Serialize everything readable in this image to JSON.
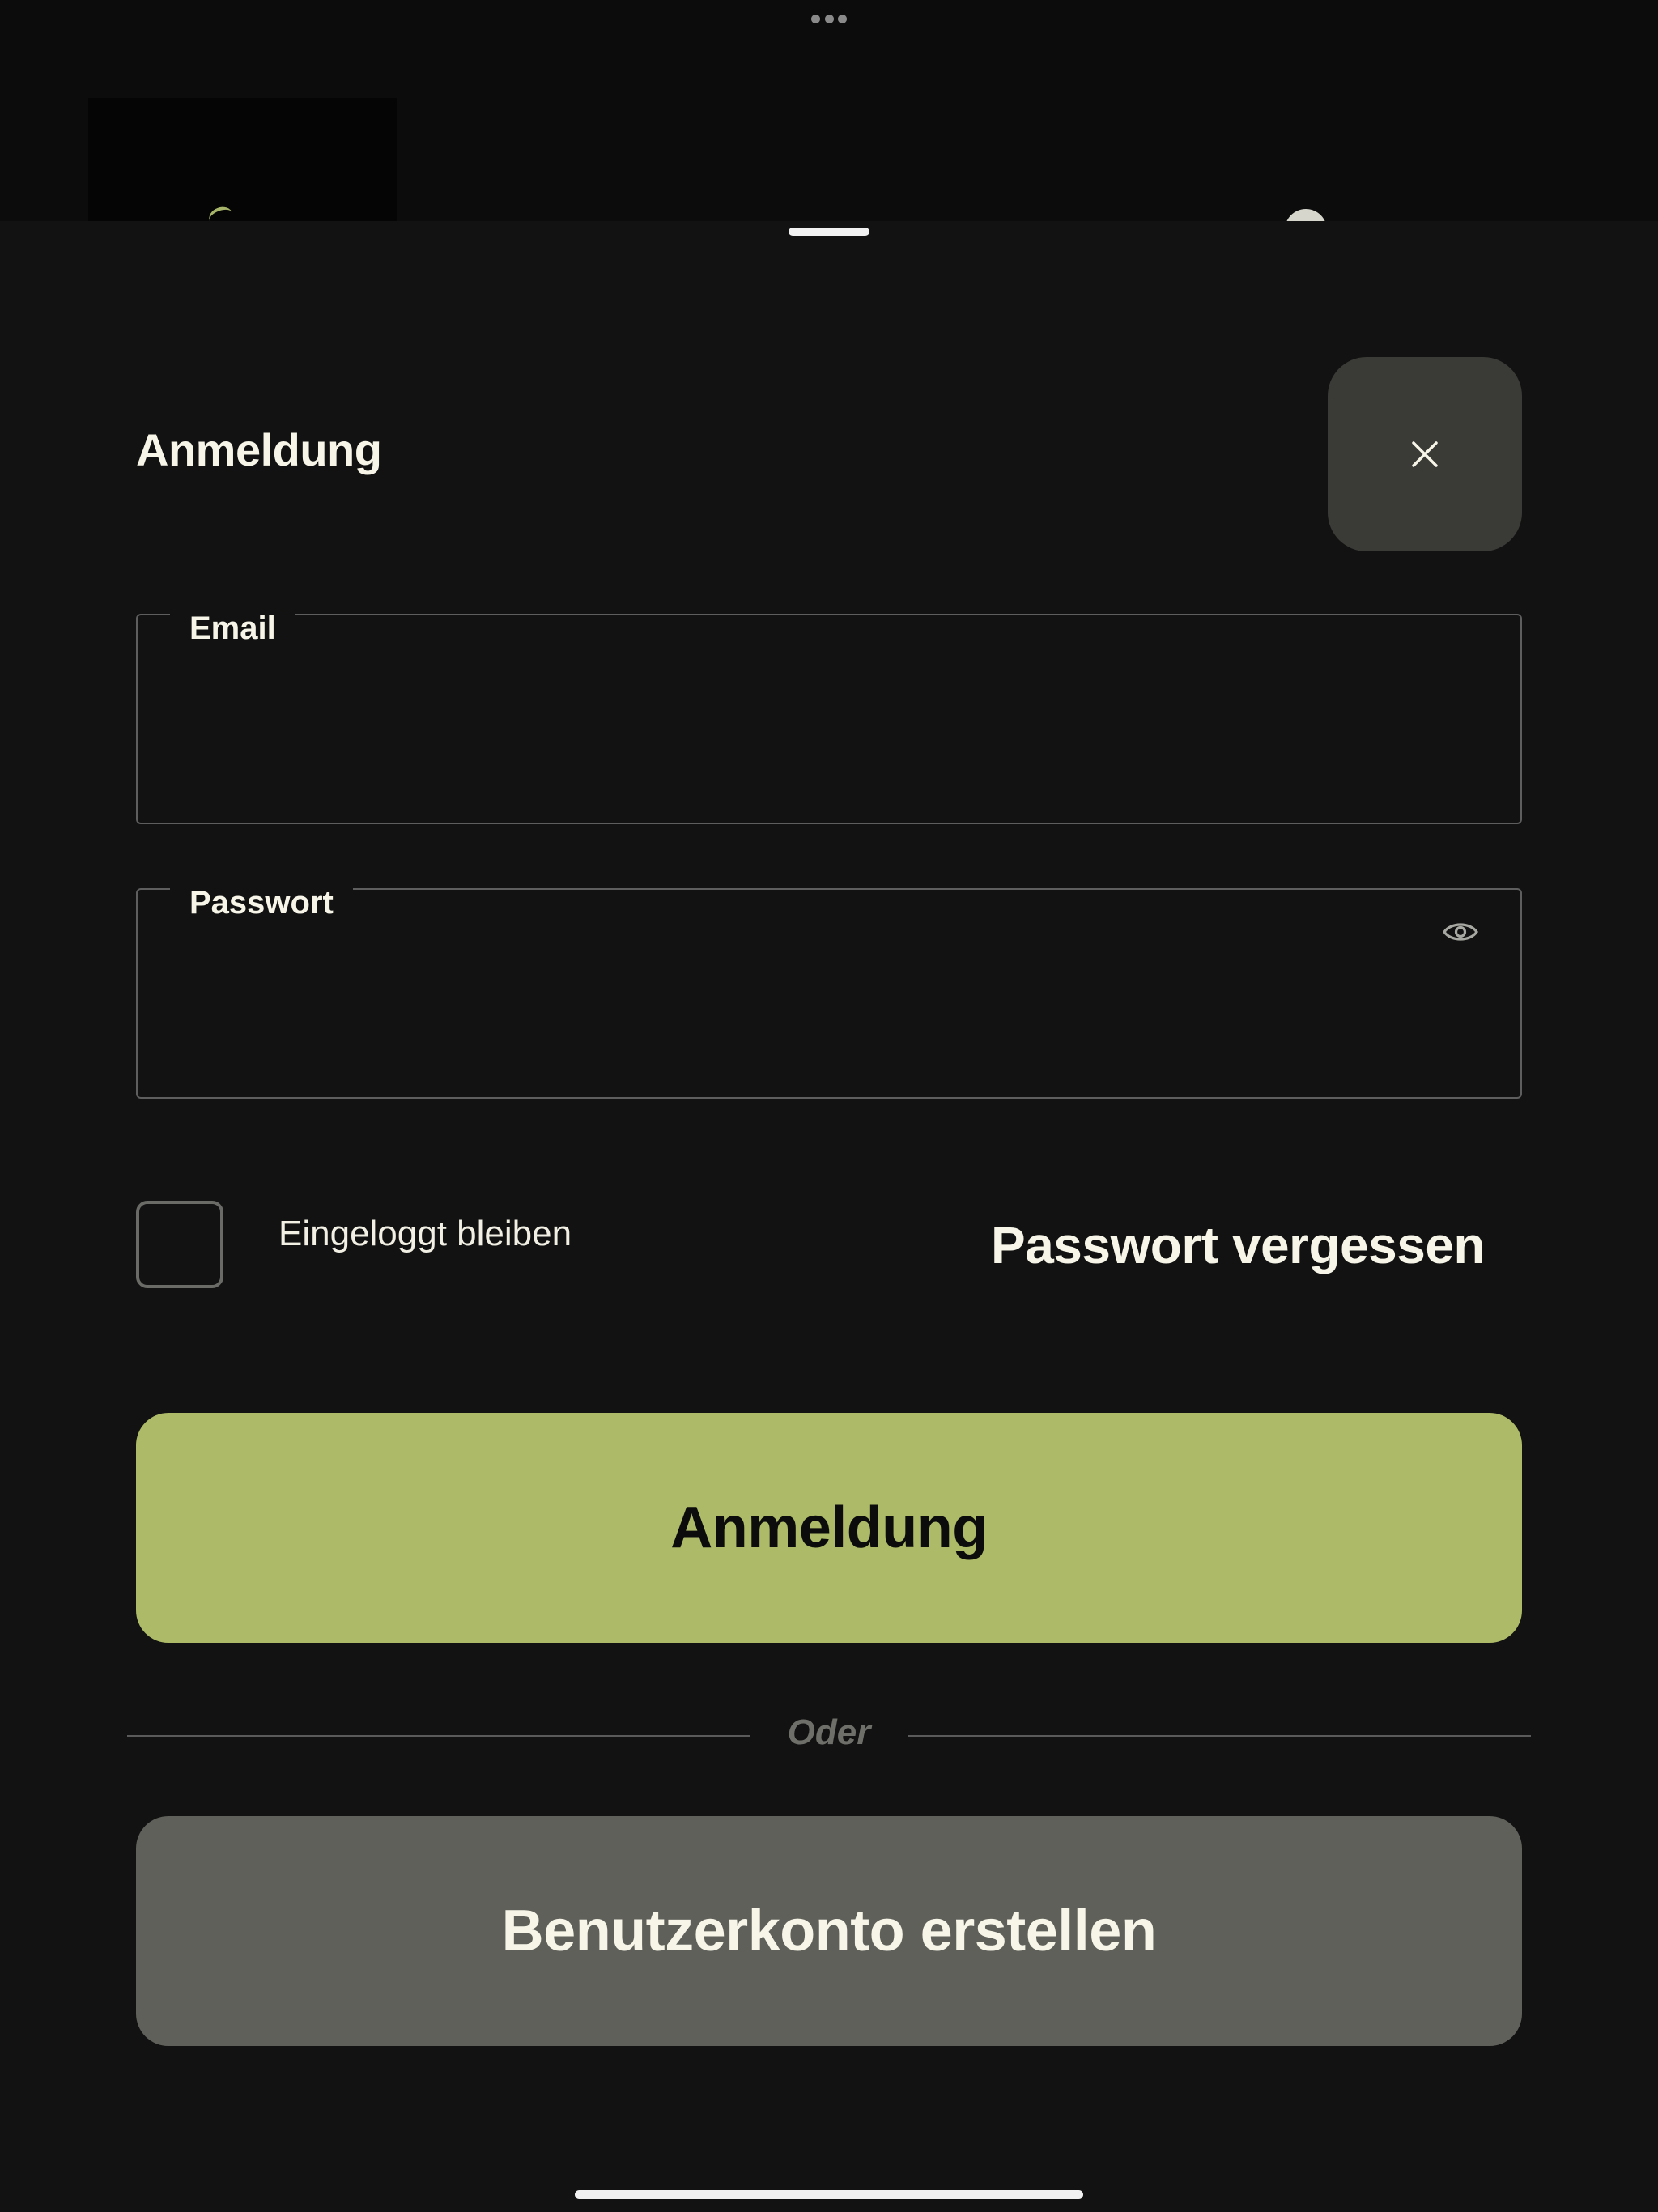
{
  "window": {
    "multitask_indicator": "ellipsis-icon"
  },
  "login_sheet": {
    "title": "Anmeldung",
    "close_icon": "close-icon",
    "email_field": {
      "label": "Email",
      "value": "",
      "placeholder": ""
    },
    "password_field": {
      "label": "Passwort",
      "value": "",
      "placeholder": "",
      "toggle_icon": "eye-icon"
    },
    "remember_me": {
      "label": "Eingeloggt bleiben",
      "checked": false
    },
    "forgot_password_label": "Passwort vergessen",
    "login_button_label": "Anmeldung",
    "divider_text": "Oder",
    "create_account_button_label": "Benutzerkonto erstellen"
  },
  "colors": {
    "background": "#121212",
    "primary_button": "#adba67",
    "secondary_button": "#5f605a",
    "close_button": "#3a3a36",
    "text_primary": "#f7f5e8",
    "divider_text": "#6f6f6a"
  }
}
